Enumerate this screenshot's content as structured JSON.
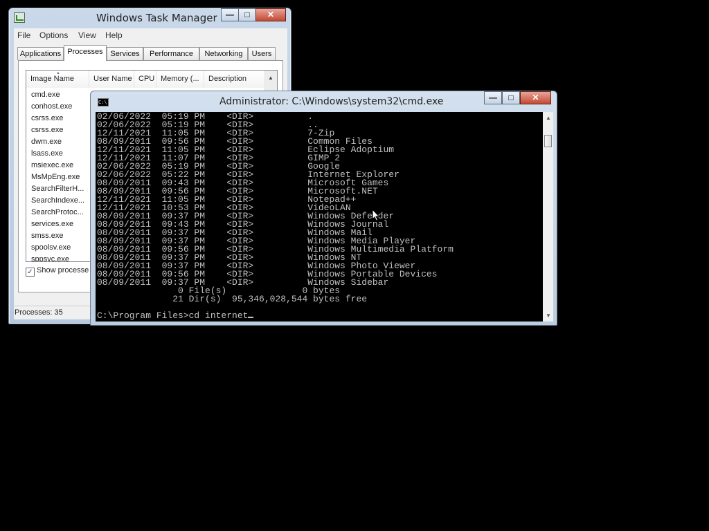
{
  "task_manager": {
    "title": "Windows Task Manager",
    "menu": [
      "File",
      "Options",
      "View",
      "Help"
    ],
    "tabs": [
      "Applications",
      "Processes",
      "Services",
      "Performance",
      "Networking",
      "Users"
    ],
    "active_tab": "Processes",
    "columns": [
      "Image Name",
      "User Name",
      "CPU",
      "Memory (...",
      "Description"
    ],
    "processes": [
      "cmd.exe",
      "conhost.exe",
      "csrss.exe",
      "csrss.exe",
      "dwm.exe",
      "lsass.exe",
      "msiexec.exe",
      "MsMpEng.exe",
      "SearchFilterH...",
      "SearchIndexe...",
      "SearchProtoc...",
      "services.exe",
      "smss.exe",
      "spoolsv.exe",
      "sppsvc.exe"
    ],
    "show_processes_label": "Show processe",
    "show_processes_checked": true,
    "status": "Processes: 35"
  },
  "cmd": {
    "title": "Administrator: C:\\Windows\\system32\\cmd.exe",
    "icon_text": "C:\\",
    "lines": [
      "02/06/2022  05:19 PM    <DIR>          .",
      "02/06/2022  05:19 PM    <DIR>          ..",
      "12/11/2021  11:05 PM    <DIR>          7-Zip",
      "08/09/2011  09:56 PM    <DIR>          Common Files",
      "12/11/2021  11:05 PM    <DIR>          Eclipse Adoptium",
      "12/11/2021  11:07 PM    <DIR>          GIMP 2",
      "02/06/2022  05:19 PM    <DIR>          Google",
      "02/06/2022  05:22 PM    <DIR>          Internet Explorer",
      "08/09/2011  09:43 PM    <DIR>          Microsoft Games",
      "08/09/2011  09:56 PM    <DIR>          Microsoft.NET",
      "12/11/2021  11:05 PM    <DIR>          Notepad++",
      "12/11/2021  10:53 PM    <DIR>          VideoLAN",
      "08/09/2011  09:37 PM    <DIR>          Windows Defender",
      "08/09/2011  09:43 PM    <DIR>          Windows Journal",
      "08/09/2011  09:37 PM    <DIR>          Windows Mail",
      "08/09/2011  09:37 PM    <DIR>          Windows Media Player",
      "08/09/2011  09:56 PM    <DIR>          Windows Multimedia Platform",
      "08/09/2011  09:37 PM    <DIR>          Windows NT",
      "08/09/2011  09:37 PM    <DIR>          Windows Photo Viewer",
      "08/09/2011  09:56 PM    <DIR>          Windows Portable Devices",
      "08/09/2011  09:37 PM    <DIR>          Windows Sidebar",
      "               0 File(s)              0 bytes",
      "              21 Dir(s)  95,346,028,544 bytes free",
      "",
      "C:\\Program Files>cd internet"
    ]
  },
  "icons": {
    "task_manager_app": "task-manager-icon",
    "cmd_app": "cmd-icon",
    "minimize": "minimize-icon",
    "maximize": "maximize-icon",
    "close": "close-icon"
  },
  "colors": {
    "desktop": "#000000",
    "console_bg": "#000000",
    "console_text": "#c0c0c0",
    "close_button": "#c24a33"
  }
}
